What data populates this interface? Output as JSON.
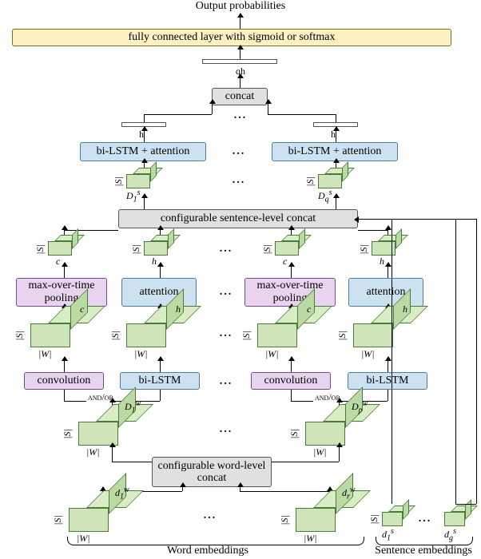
{
  "top": {
    "title": "Output probabilities",
    "fc": "fully connected layer with sigmoid or softmax"
  },
  "qh": "qh",
  "concat": "concat",
  "bilstm_att": "bi-LSTM + attention",
  "sent_concat": "configurable sentence-level concat",
  "maxpool": "max-over-time pooling",
  "attention": "attention",
  "convolution": "convolution",
  "bilstm": "bi-LSTM",
  "andor": "and/or",
  "wconcat": "configurable word-level concat",
  "dims": {
    "S": "|S|",
    "W": "|W|",
    "h": "h",
    "c": "c",
    "Dqs": "D",
    "sup": "s",
    "q": "q",
    "1": "1",
    "p": "p",
    "r": "r",
    "g": "g",
    "d_lower": "d"
  },
  "bottom": {
    "word": "Word embeddings",
    "sent": "Sentence embeddings"
  },
  "ellipsis": "..."
}
